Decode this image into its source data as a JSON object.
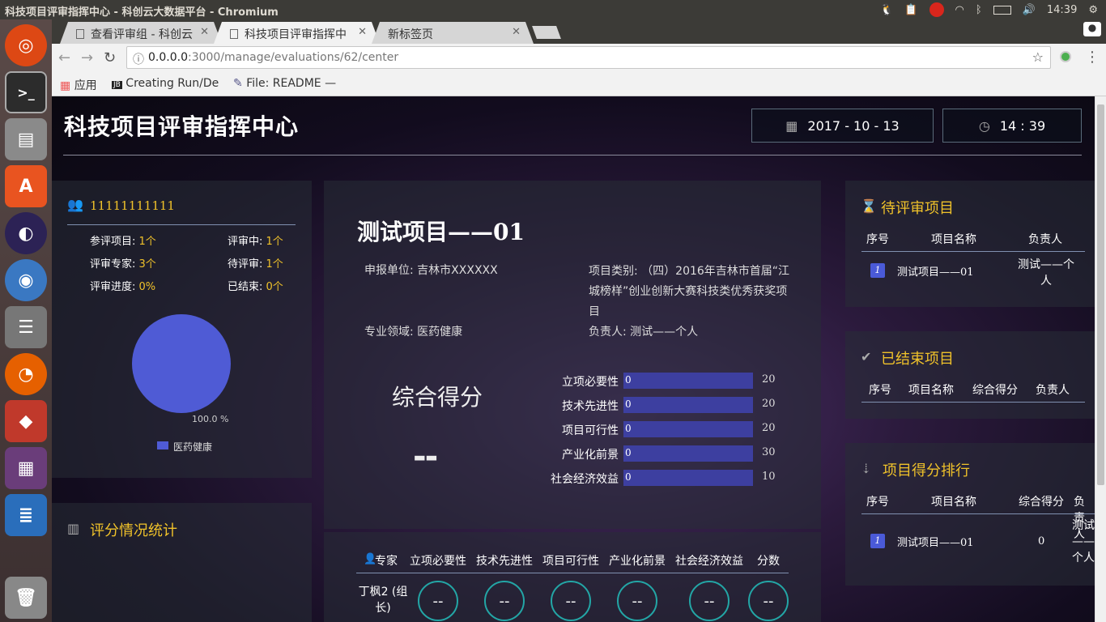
{
  "os": {
    "window_title": "科技项目评审指挥中心 - 科创云大数据平台 - Chromium",
    "clock": "14:39"
  },
  "browser": {
    "tabs": [
      {
        "label": "查看评审组 - 科创云"
      },
      {
        "label": "科技项目评审指挥中"
      },
      {
        "label": "新标签页"
      }
    ],
    "url_host": "0.0.0.0",
    "url_path": ":3000/manage/evaluations/62/center",
    "bookmarks": [
      {
        "label": "应用"
      },
      {
        "label": "Creating Run/De"
      },
      {
        "label": "File: README —"
      }
    ]
  },
  "header": {
    "title": "科技项目评审指挥中心",
    "date": "2017 - 10 - 13",
    "time": "14 : 39"
  },
  "group": {
    "name": "11111111111",
    "stats": [
      {
        "label": "参评项目:",
        "value": "1个"
      },
      {
        "label": "评审中:",
        "value": "1个"
      },
      {
        "label": "评审专家:",
        "value": "3个"
      },
      {
        "label": "待评审:",
        "value": "1个"
      },
      {
        "label": "评审进度:",
        "value": "0%"
      },
      {
        "label": "已结束:",
        "value": "0个"
      }
    ],
    "pie_label": "100.0 %",
    "pie_legend": "医药健康",
    "pie_color": "#4f5bd5"
  },
  "score_stats": {
    "title": "评分情况统计"
  },
  "project": {
    "title": "测试项目——01",
    "unit": "申报单位: 吉林市XXXXXX",
    "category": "项目类别: （四）2016年吉林市首届“江城榜样”创业创新大赛科技类优秀获奖项目",
    "field": "专业领域: 医药健康",
    "leader": "负责人: 测试——个人",
    "score_title": "综合得分",
    "score_value": "--",
    "criteria": [
      {
        "label": "立项必要性",
        "value": "0",
        "max": "20"
      },
      {
        "label": "技术先进性",
        "value": "0",
        "max": "20"
      },
      {
        "label": "项目可行性",
        "value": "0",
        "max": "20"
      },
      {
        "label": "产业化前景",
        "value": "0",
        "max": "30"
      },
      {
        "label": "社会经济效益",
        "value": "0",
        "max": "10"
      }
    ]
  },
  "experts": {
    "headers": [
      "专家",
      "立项必要性",
      "技术先进性",
      "项目可行性",
      "产业化前景",
      "社会经济效益",
      "分数"
    ],
    "rows": [
      {
        "name": "丁枫2 (组长)",
        "scores": [
          "--",
          "--",
          "--",
          "--",
          "--",
          "--"
        ]
      }
    ]
  },
  "pending": {
    "title": "待评审项目",
    "headers": [
      "序号",
      "项目名称",
      "负责人"
    ],
    "rows": [
      {
        "no": "1",
        "name": "测试项目——01",
        "leader": "测试——个人"
      }
    ]
  },
  "finished": {
    "title": "已结束项目",
    "headers": [
      "序号",
      "项目名称",
      "综合得分",
      "负责人"
    ]
  },
  "ranking": {
    "title": "项目得分排行",
    "headers": [
      "序号",
      "项目名称",
      "综合得分",
      "负责人"
    ],
    "rows": [
      {
        "no": "1",
        "name": "测试项目——01",
        "score": "0",
        "leader": "测试——个人"
      }
    ]
  }
}
